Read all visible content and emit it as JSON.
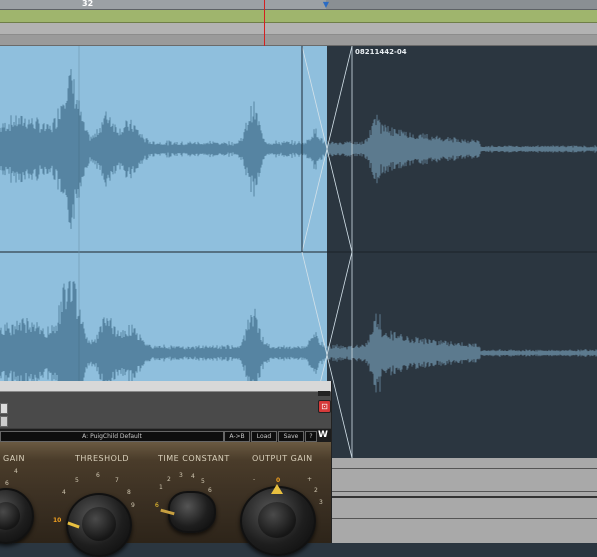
{
  "timeline": {
    "bar_number": "32",
    "clip_name": "08211442-04"
  },
  "plugin": {
    "preset_name": "A: PuigChild Default",
    "compare_label": "A->B",
    "load_label": "Load",
    "save_label": "Save",
    "help_label": "?",
    "close_label": "⊡",
    "logo": "W",
    "controls": {
      "gain_label": "GAIN",
      "threshold_label": "THRESHOLD",
      "time_constant_label": "TIME CONSTANT",
      "output_gain_label": "OUTPUT  GAIN"
    },
    "threshold_scale": [
      "4",
      "5",
      "6",
      "7",
      "8",
      "9"
    ],
    "threshold_low": "10",
    "time_constant_scale": [
      "1",
      "2",
      "3",
      "4",
      "5",
      "6"
    ],
    "time_constant_selected": "6",
    "output_scale": [
      "-",
      "0",
      "+"
    ],
    "output_marks": [
      "2",
      "3"
    ],
    "gain_scale": [
      "6",
      "4"
    ]
  },
  "colors": {
    "selection": "#8fbfdd",
    "waveform_selected": "#1e4a66",
    "waveform_unselected": "#8fbfdd",
    "track_bg": "#2b3640",
    "playhead": "#d42020",
    "ruler_green": "#9fb56d"
  }
}
